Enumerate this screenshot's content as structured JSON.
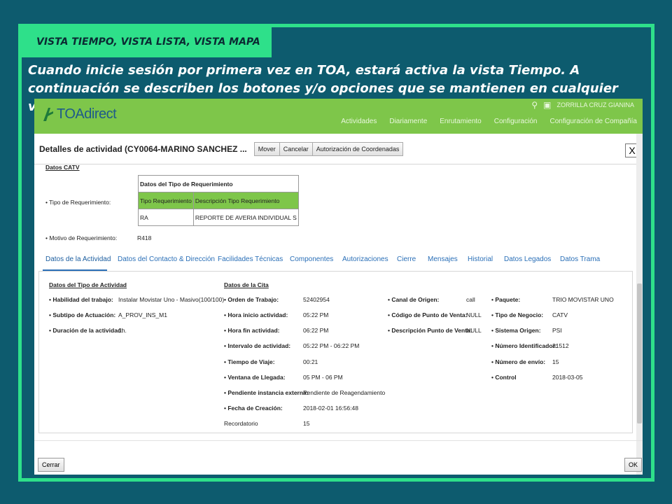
{
  "slide": {
    "heading": "VISTA TIEMPO, VISTA LISTA, VISTA MAPA",
    "body": "Cuando inicie sesión por primera vez en TOA, estará activa la vista Tiempo. A continuación se describen los botones y/o opciones que se mantienen en cualquier vista:"
  },
  "app": {
    "logo": "TOAdirect",
    "user": "ZORRILLA CRUZ GIANINA",
    "nav": [
      "Actividades",
      "Diariamente",
      "Enrutamiento",
      "Configuración",
      "Configuración de Compañía"
    ],
    "accent": "#7ec64a"
  },
  "dialog": {
    "title": "Detalles de actividad (CY0064-MARINO SANCHEZ ...",
    "buttons": {
      "move": "Mover",
      "cancel": "Cancelar",
      "auth": "Autorización de Coordenadas"
    },
    "close": "X",
    "upper": {
      "section": "Datos CATV",
      "tipo_label": "• Tipo de Requerimiento:",
      "motivo_label": "• Motivo de Requerimiento:",
      "motivo_value": "R418",
      "table_title": "Datos del Tipo de Requerimiento",
      "col1": "Tipo Requerimiento",
      "col2": "Descripción Tipo Requerimiento",
      "val1": "RA",
      "val2": "REPORTE DE AVERIA INDIVIDUAL S"
    },
    "tabs": [
      "Datos de la Actividad",
      "Datos del Contacto & Dirección",
      "Facilidades Técnicas",
      "Componentes",
      "Autorizaciones",
      "Cierre",
      "Mensajes",
      "Historial",
      "Datos Legados",
      "Datos Trama"
    ],
    "col1": {
      "header": "Datos del Tipo de Actividad",
      "rows": [
        {
          "label": "• Habilidad del trabajo:",
          "value": "Instalar Movistar Uno - Masivo(100/100)"
        },
        {
          "label": "• Subtipo de Actuación:",
          "value": "A_PROV_INS_M1"
        },
        {
          "label": "• Duración de la actividad:",
          "value": "1h."
        }
      ]
    },
    "col2": {
      "header": "Datos de la Cita",
      "rows": [
        {
          "label": "• Orden de Trabajo:",
          "value": "52402954"
        },
        {
          "label": "• Hora inicio actividad:",
          "value": "05:22 PM"
        },
        {
          "label": "• Hora fin actividad:",
          "value": "06:22 PM"
        },
        {
          "label": "• Intervalo de actividad:",
          "value": "05:22 PM - 06:22 PM"
        },
        {
          "label": "• Tiempo de Viaje:",
          "value": "00:21"
        },
        {
          "label": "• Ventana de Llegada:",
          "value": "05 PM - 06 PM"
        },
        {
          "label": "• Pendiente instancia externa:",
          "value": "Pendiente de Reagendamiento"
        },
        {
          "label": "• Fecha de Creación:",
          "value": "2018-02-01 16:56:48"
        },
        {
          "label": "Recordatorio",
          "value": "15"
        }
      ]
    },
    "col3": {
      "rows": [
        {
          "label": "• Canal de Origen:",
          "value": "call"
        },
        {
          "label": "• Código de Punto de Venta:",
          "value": "NULL"
        },
        {
          "label": "• Descripción Punto de Venta:",
          "value": "NULL"
        }
      ]
    },
    "col4": {
      "rows": [
        {
          "label": "• Paquete:",
          "value": "TRIO MOVISTAR UNO"
        },
        {
          "label": "• Tipo de Negocio:",
          "value": "CATV"
        },
        {
          "label": "• Sistema Origen:",
          "value": "PSI"
        },
        {
          "label": "• Número Identificador:",
          "value": "31512"
        },
        {
          "label": "• Número de envío:",
          "value": "15"
        },
        {
          "label": "• Control",
          "value": "2018-03-05"
        }
      ]
    },
    "footer": {
      "close": "Cerrar",
      "ok": "OK"
    }
  }
}
